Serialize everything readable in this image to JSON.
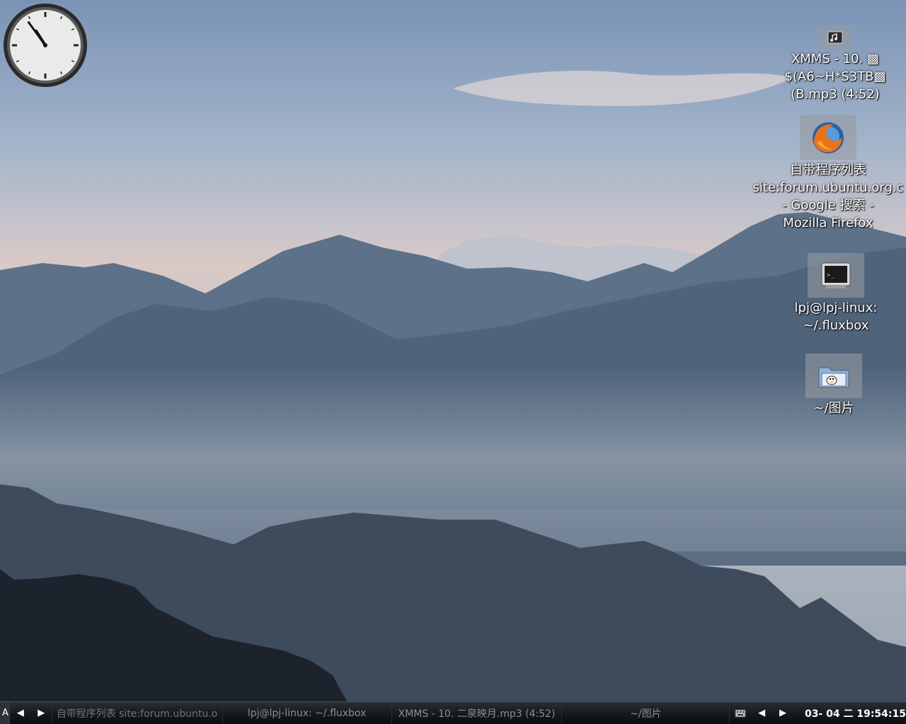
{
  "desktop": {
    "icons": [
      {
        "id": "xmms",
        "caption": "XMMS - 10. ▩\n$(A6~H*S3TB▩\n(B.mp3 (4:52)",
        "icon": "xmms-icon"
      },
      {
        "id": "firefox",
        "caption": "自带程序列表\nsite:forum.ubuntu.org.c\n- Google 搜索 -\nMozilla Firefox",
        "icon": "firefox-icon"
      },
      {
        "id": "terminal",
        "caption": "lpj@lpj-linux:\n~/.fluxbox",
        "icon": "terminal-icon"
      },
      {
        "id": "pictures",
        "caption": "~/图片",
        "icon": "folder-icon"
      }
    ],
    "clock": {
      "hour": 10,
      "minute": 54
    }
  },
  "taskbar": {
    "workspace": "A",
    "tasks": [
      {
        "label": "自带程序列表 site:forum.ubuntu.o"
      },
      {
        "label": "lpj@lpj-linux: ~/.fluxbox"
      },
      {
        "label": "XMMS - 10. 二泉映月.mp3 (4:52)"
      },
      {
        "label": "~/图片"
      }
    ],
    "clock": "03- 04 二 19:54:15"
  },
  "colors": {
    "taskbar_bg": "#15181c",
    "taskbar_text": "#8c9096",
    "icon_text": "#ffffff"
  }
}
